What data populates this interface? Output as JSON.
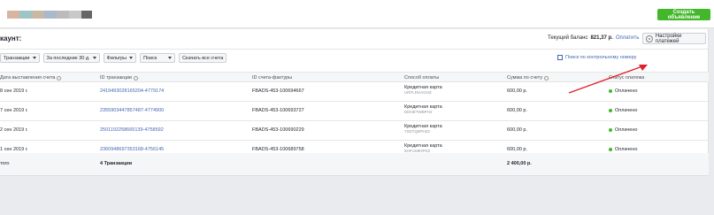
{
  "topbar": {
    "swatch_colors": [
      "#d8b5a0",
      "#9fc4c8",
      "#c9b8a4",
      "#a9b9c9",
      "#bbbbbb",
      "#c8c8c8",
      "#666666"
    ],
    "create_button": "Создать объявление"
  },
  "account": {
    "title": "каунт:",
    "balance_label": "Текущий баланс",
    "balance_amount": "821,37 р.",
    "pay_link": "Оплатить",
    "settings_button": "Настройки платежей"
  },
  "filters": {
    "items": [
      {
        "label": "Транзакции",
        "caret": true
      },
      {
        "label": "За последние 30 д.",
        "caret": true
      },
      {
        "label": "Фильтры",
        "caret": true
      },
      {
        "label": "Поиск",
        "caret": true
      },
      {
        "label": "Скачать все счета",
        "caret": false
      }
    ],
    "search_by_number": "Поиск по контрольному номеру"
  },
  "table": {
    "headers": {
      "date": "Дата выставления счета",
      "txn_id": "ID транзакции",
      "invoice_id": "ID счета-фактуры",
      "payment": "Способ оплаты",
      "amount": "Сумма по счету",
      "status": "Статус платежа"
    },
    "rows": [
      {
        "date": "8 сен 2019 г.",
        "txn_id": "2419493028165204-4779174",
        "invoice_id": "FBADS-453-100694667",
        "pay_method": "Кредитная карта",
        "pay_ref": "URFLRHAGHZ",
        "amount": "600,00 р.",
        "status": "Оплачено"
      },
      {
        "date": "7 сен 2019 г.",
        "txn_id": "2355903447857487-4774900",
        "invoice_id": "FBADS-453-100693727",
        "pay_method": "Кредитная карта",
        "pay_ref": "DDHETWBPH2",
        "amount": "600,00 р.",
        "status": "Оплачено"
      },
      {
        "date": "2 сен 2019 г.",
        "txn_id": "2501192258665139-4758592",
        "invoice_id": "FBADS-453-100690229",
        "pay_method": "Кредитная карта",
        "pay_ref": "7SDTQ8PHZ2",
        "amount": "600,00 р.",
        "status": "Оплачено"
      },
      {
        "date": "1 сен 2019 г.",
        "txn_id": "2360948697353168-4756145",
        "invoice_id": "FBADS-453-100689758",
        "pay_method": "Кредитная карта",
        "pay_ref": "5HFUS9HPKZ",
        "amount": "600,00 р.",
        "status": "Оплачено"
      }
    ],
    "total": {
      "label": "того",
      "count": "4 Транзакции",
      "amount": "2 400,00 р."
    }
  },
  "annotation": {
    "arrow_color": "#e0202a"
  }
}
